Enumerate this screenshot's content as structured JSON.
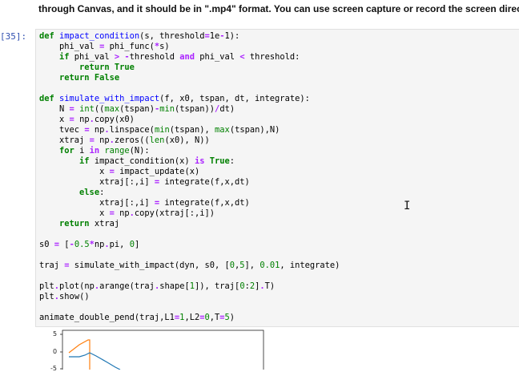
{
  "instructions": {
    "line1": "",
    "line2": "through Canvas, and it should be in \".mp4\" format. You can use screen capture or record the screen directly with your"
  },
  "cell": {
    "prompt": "[35]:"
  },
  "plot": {
    "y_ticks": [
      "5",
      "0",
      "-5"
    ],
    "colors": {
      "series1": "#1f77b4",
      "series2": "#ff7f0e"
    }
  },
  "colors": {
    "keyword": "#008000",
    "function": "#0000ff",
    "operator": "#aa22ff",
    "prompt": "#3050b0",
    "cell_bg": "#f5f5f5"
  }
}
